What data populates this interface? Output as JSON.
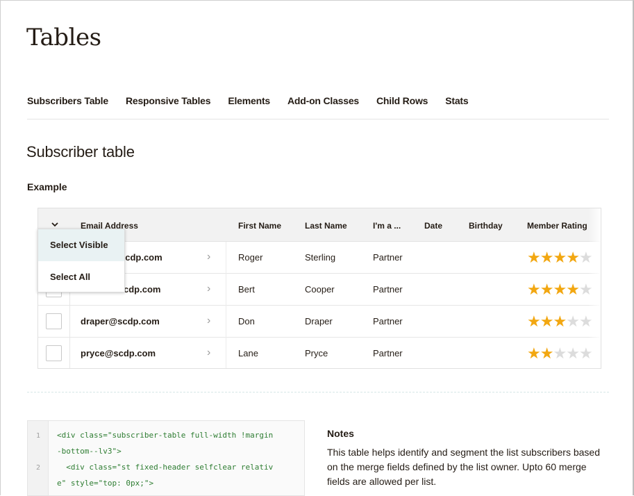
{
  "page": {
    "title": "Tables"
  },
  "tabs": [
    {
      "label": "Subscribers Table"
    },
    {
      "label": "Responsive Tables"
    },
    {
      "label": "Elements"
    },
    {
      "label": "Add-on Classes"
    },
    {
      "label": "Child Rows"
    },
    {
      "label": "Stats"
    }
  ],
  "section": {
    "title": "Subscriber table",
    "example_label": "Example"
  },
  "table": {
    "columns": [
      "Email Address",
      "First Name",
      "Last Name",
      "I'm a ...",
      "Date",
      "Birthday",
      "Member Rating"
    ],
    "rows": [
      {
        "email": "scdp.com",
        "first": "Roger",
        "last": "Sterling",
        "type": "Partner",
        "date": "",
        "birthday": "",
        "rating": 4
      },
      {
        "email": "cdp.com",
        "first": "Bert",
        "last": "Cooper",
        "type": "Partner",
        "date": "",
        "birthday": "",
        "rating": 4
      },
      {
        "email": "draper@scdp.com",
        "first": "Don",
        "last": "Draper",
        "type": "Partner",
        "date": "",
        "birthday": "",
        "rating": 3
      },
      {
        "email": "pryce@scdp.com",
        "first": "Lane",
        "last": "Pryce",
        "type": "Partner",
        "date": "",
        "birthday": "",
        "rating": 2
      }
    ],
    "max_rating": 5,
    "star_on_color": "#f2a711",
    "star_off_color": "#dcdcdc",
    "row_arrow": "›"
  },
  "dropdown": {
    "items": [
      {
        "label": "Select Visible",
        "active": true
      },
      {
        "label": "Select All",
        "active": false
      }
    ]
  },
  "code": {
    "line_numbers": [
      "1",
      "2"
    ],
    "lines": [
      "<div class=\"subscriber-table full-width !margin",
      "-bottom--lv3\">",
      "  <div class=\"st fixed-header selfclear relativ",
      "e\" style=\"top: 0px;\">"
    ]
  },
  "notes": {
    "title": "Notes",
    "body": "This table helps identify and segment the list subscribers based on the merge fields defined by the list owner. Upto 60 merge fields are allowed per list."
  },
  "colors": {
    "accent_selected": "#e9f2f3",
    "header_bg": "#f2f2f2"
  }
}
